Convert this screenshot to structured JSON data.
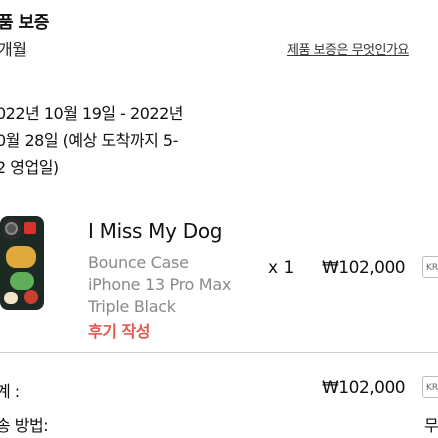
{
  "section": {
    "title": "품 보증",
    "subtitle": "개월",
    "warranty_link": "제품 보증은 무엇인가요"
  },
  "delivery": {
    "lines": [
      "022년 10월 19일 - 2022년",
      "0월 28일 (예상 도착까지 5-",
      "2 영업일)"
    ]
  },
  "product": {
    "name": "I Miss My Dog",
    "type": "Bounce Case",
    "model": "iPhone 13 Pro Max",
    "color": "Triple Black",
    "review_label": "후기 작성",
    "quantity": "x 1",
    "price": "₩102,000",
    "currency_badge": "KRW"
  },
  "summary": {
    "total_label": "계 :",
    "total_value": "₩102,000",
    "total_currency_badge": "KRW",
    "shipping_label": "송 방법:",
    "shipping_value": "무"
  },
  "colors": {
    "accent_review": "#e25a4f",
    "secondary_text": "#8a8a8a",
    "divider": "#cfcfcf"
  }
}
